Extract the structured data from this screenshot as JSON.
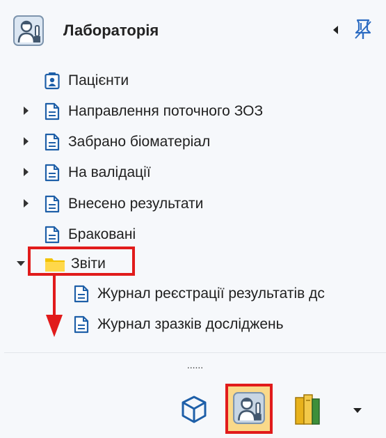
{
  "header": {
    "title": "Лабораторія"
  },
  "tree": [
    {
      "label": "Пацієнти",
      "icon": "patient-card-icon",
      "expandable": false
    },
    {
      "label": "Направлення поточного ЗОЗ",
      "icon": "document-icon",
      "expandable": true
    },
    {
      "label": "Забрано біоматеріал",
      "icon": "document-icon",
      "expandable": true
    },
    {
      "label": "На валідації",
      "icon": "document-icon",
      "expandable": true
    },
    {
      "label": "Внесено результати",
      "icon": "document-icon",
      "expandable": true
    },
    {
      "label": "Браковані",
      "icon": "document-icon",
      "expandable": false
    },
    {
      "label": "Звіти",
      "icon": "folder-icon",
      "expandable": true,
      "expanded": true,
      "children": [
        {
          "label": "Журнал реєстрації результатів дс",
          "icon": "document-icon"
        },
        {
          "label": "Журнал зразків досліджень",
          "icon": "document-icon"
        }
      ]
    }
  ],
  "splitter": {
    "dots": "......"
  },
  "bottom_bar": {
    "buttons": [
      "cube-icon",
      "laboratory-assistant-icon",
      "books-icon",
      "dropdown-arrow-icon"
    ]
  },
  "colors": {
    "accent": "#1e5fa8",
    "highlight": "#e11b1b",
    "folder": "#f2c200"
  }
}
